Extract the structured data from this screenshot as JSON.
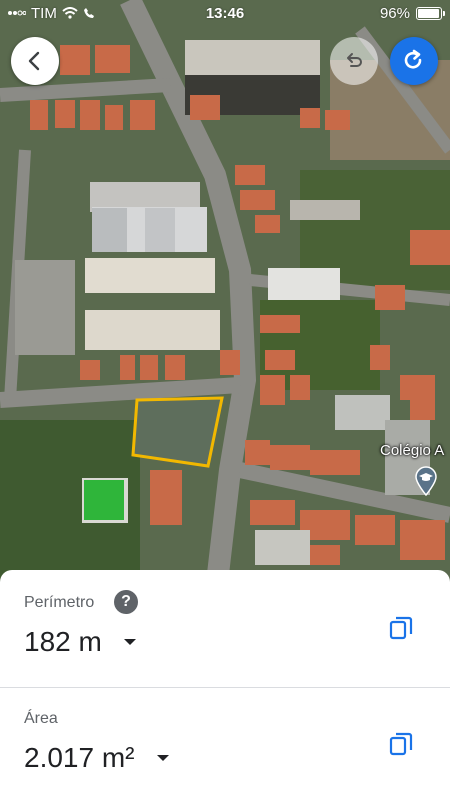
{
  "status_bar": {
    "carrier": "TIM",
    "time": "13:46",
    "battery": "96%",
    "battery_level": 0.96
  },
  "map": {
    "place_label": "Colégio A",
    "place_icon": "school-pin-icon",
    "outline_color": "#f2b800"
  },
  "controls": {
    "back_icon": "chevron-left-icon",
    "undo_icon": "undo-icon",
    "redo_icon": "redo-icon",
    "accent": "#1a73e8"
  },
  "measurements": {
    "perimeter": {
      "label": "Perímetro",
      "value": "182 m"
    },
    "area": {
      "label": "Área",
      "value": "2.017 m²"
    }
  }
}
